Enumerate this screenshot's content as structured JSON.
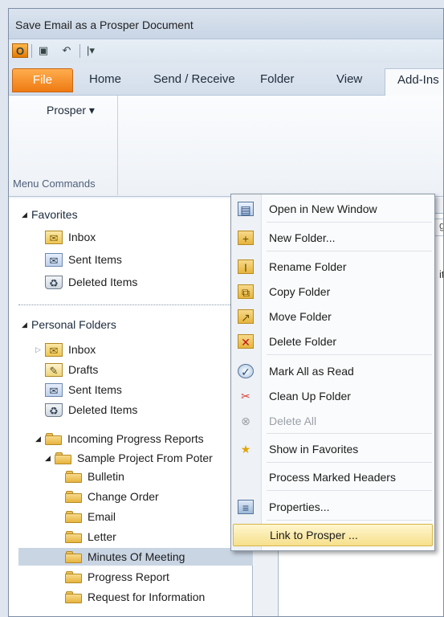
{
  "window": {
    "title": "Save Email as a Prosper Document"
  },
  "quick_access": {
    "office_icon": "outlook-icon",
    "save_icon": "save-icon",
    "undo_icon": "undo-icon",
    "customize_glyph": "|▾"
  },
  "tabs": [
    "File",
    "Home",
    "Send / Receive",
    "Folder",
    "View",
    "Add-Ins"
  ],
  "active_tab": "Add-Ins",
  "ribbon": {
    "prosper_button": "Prosper ▾",
    "group_label": "Menu Commands"
  },
  "nav": {
    "favorites": {
      "label": "Favorites",
      "items": [
        "Inbox",
        "Sent Items",
        "Deleted Items"
      ]
    },
    "personal": {
      "label": "Personal Folders",
      "items": [
        "Inbox",
        "Drafts",
        "Sent Items",
        "Deleted Items"
      ]
    },
    "incoming": {
      "label": "Incoming Progress Reports",
      "project": "Sample Project From Poter",
      "subfolders": [
        "Bulletin",
        "Change Order",
        "Email",
        "Letter",
        "Minutes Of Meeting",
        "Progress Report",
        "Request for Information"
      ],
      "selected": "Minutes Of Meeting"
    }
  },
  "content": {
    "search_fragment": "g",
    "peek_fragment": "it"
  },
  "context_menu": {
    "items": [
      {
        "label": "Open in New Window",
        "icon": "new-window-icon",
        "enabled": true
      },
      {
        "label": "New Folder...",
        "icon": "new-folder-icon",
        "enabled": true
      },
      {
        "label": "Rename Folder",
        "icon": "rename-folder-icon",
        "enabled": true
      },
      {
        "label": "Copy Folder",
        "icon": "copy-folder-icon",
        "enabled": true
      },
      {
        "label": "Move Folder",
        "icon": "move-folder-icon",
        "enabled": true
      },
      {
        "label": "Delete Folder",
        "icon": "delete-folder-icon",
        "enabled": true
      },
      {
        "label": "Mark All as Read",
        "icon": "mark-read-icon",
        "enabled": true
      },
      {
        "label": "Clean Up Folder",
        "icon": "clean-up-icon",
        "enabled": true
      },
      {
        "label": "Delete All",
        "icon": "delete-all-icon",
        "enabled": false
      },
      {
        "label": "Show in Favorites",
        "icon": "favorites-star-icon",
        "enabled": true
      },
      {
        "label": "Process Marked Headers",
        "icon": "",
        "enabled": true
      },
      {
        "label": "Properties...",
        "icon": "properties-icon",
        "enabled": true
      },
      {
        "label": "Link to Prosper ...",
        "icon": "",
        "enabled": true,
        "highlighted": true
      }
    ]
  },
  "colors": {
    "file_tab": "#ee7a12",
    "selection": "#c9d5e3",
    "menu_highlight": "#f6e08b"
  }
}
